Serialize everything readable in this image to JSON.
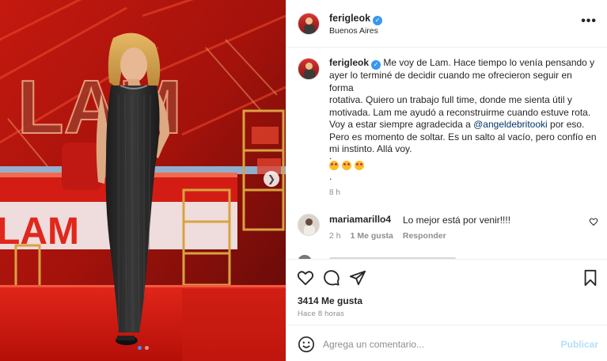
{
  "post": {
    "username": "ferigleok",
    "location": "Buenos Aires",
    "more_icon": "ellipsis-icon",
    "verified_icon": "verified-badge-icon"
  },
  "photo": {
    "description_icon": "tv-studio-photo",
    "set_logo_text": "LAM",
    "carousel": {
      "count": 2,
      "active_index": 0
    },
    "next_icon": "chevron-right-icon"
  },
  "caption": {
    "username": "ferigleok",
    "lines": [
      "Me voy de Lam. Hace tiempo lo venía pensando y",
      "ayer lo terminé de decidir cuando me ofrecieron seguir en forma",
      "rotativa. Quiero un trabajo full time, donde me sienta útil y",
      "motivada. Lam me ayudó a reconstruirme cuando estuve rota."
    ],
    "line5_before": "Voy a estar siempre agradecida a ",
    "mention": "@angeldebritooki",
    "line5_after": " por eso.",
    "lines_end": [
      "Pero es momento de soltar. Es un salto al vacío, pero confío en",
      "mi instinto. Allá voy."
    ],
    "dot1": ".",
    "dot2": ".",
    "dot3": ".",
    "emoji_names": [
      "heart-eyes-emoji",
      "heart-eyes-emoji",
      "heart-eyes-emoji"
    ],
    "time": "8 h"
  },
  "comment": {
    "username": "mariamarillo4",
    "text": "Lo mejor está por venir!!!!",
    "time": "2 h",
    "likes": "1 Me gusta",
    "reply": "Responder",
    "like_icon": "heart-outline-icon"
  },
  "actions": {
    "like_icon": "heart-icon",
    "comment_icon": "comment-icon",
    "share_icon": "send-icon",
    "save_icon": "bookmark-icon",
    "likes_text": "3414 Me gusta",
    "ago_text": "Hace 8 horas"
  },
  "add_comment": {
    "emoji_icon": "smiley-icon",
    "placeholder": "Agrega un comentario...",
    "publish_label": "Publicar"
  },
  "colors": {
    "link_blue": "#00376b",
    "accent_blue": "#3897f0",
    "publish_disabled": "#b2dffc",
    "studio_red": "#d81f17"
  }
}
